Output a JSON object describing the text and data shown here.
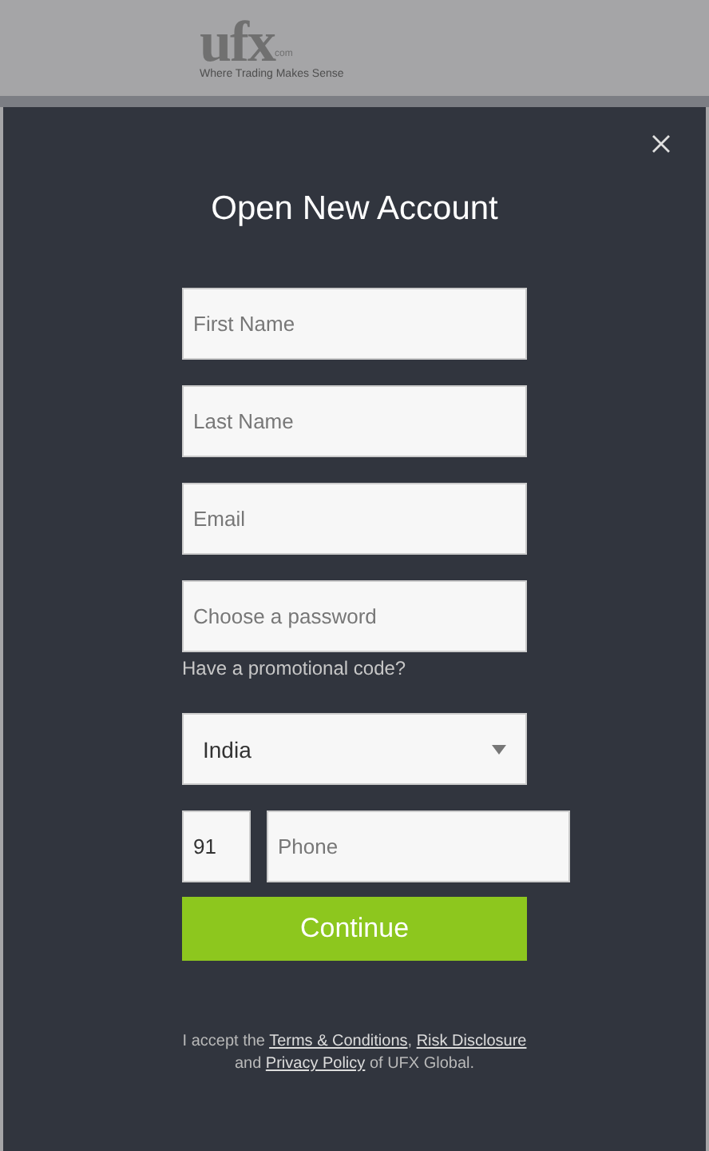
{
  "header": {
    "logo": "ufx",
    "logo_suffix": "com",
    "tagline": "Where Trading Makes Sense"
  },
  "modal": {
    "title": "Open New Account",
    "fields": [
      {
        "placeholder": "First Name"
      },
      {
        "placeholder": "Last Name"
      },
      {
        "placeholder": "Email"
      },
      {
        "placeholder": "Choose a password"
      }
    ],
    "promo_link": "Have a promotional code?",
    "country": {
      "value": "India"
    },
    "phone": {
      "code": "91",
      "placeholder": "Phone"
    },
    "submit": "Continue",
    "terms": [
      {
        "kind": "text",
        "text": "I accept the "
      },
      {
        "kind": "link",
        "text": "Terms & Conditions"
      },
      {
        "kind": "text",
        "text": ", "
      },
      {
        "kind": "link",
        "text": "Risk Disclosure"
      },
      {
        "kind": "text",
        "text": " and "
      },
      {
        "kind": "link",
        "text": "Privacy Policy"
      },
      {
        "kind": "text",
        "text": " of UFX Global."
      }
    ]
  }
}
